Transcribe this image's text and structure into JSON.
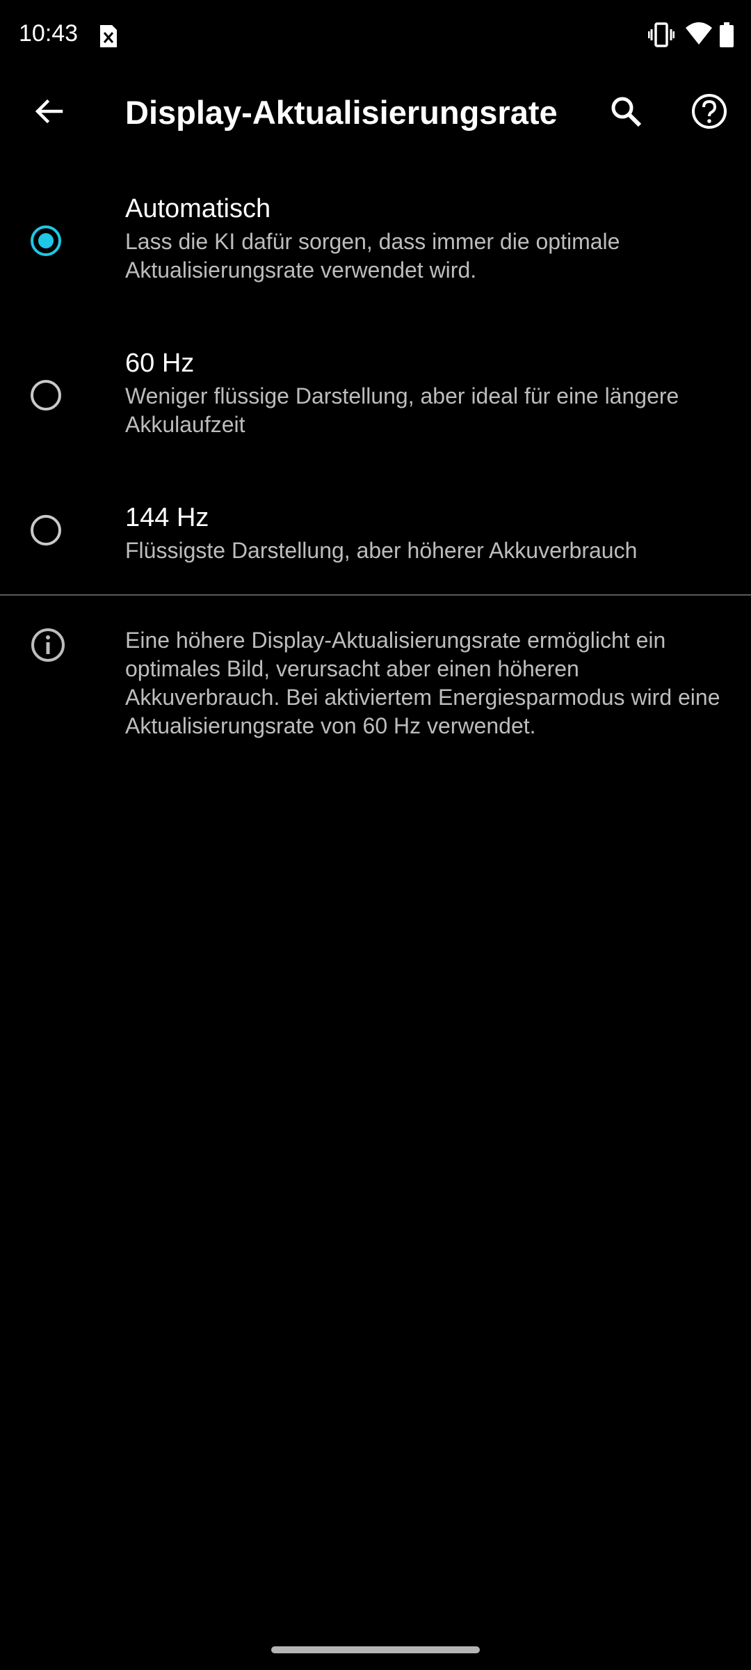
{
  "status_bar": {
    "time": "10:43",
    "icons": [
      "sim-error-icon",
      "vibrate-icon",
      "wifi-icon",
      "battery-icon"
    ]
  },
  "app_bar": {
    "title": "Display-Aktualisierungsrate",
    "actions": [
      "back-arrow-icon",
      "search-icon",
      "help-icon"
    ]
  },
  "options": [
    {
      "title": "Automatisch",
      "description": "Lass die KI dafür sorgen, dass immer die optimale Aktualisierungsrate verwendet wird.",
      "selected": true
    },
    {
      "title": "60 Hz",
      "description": "Weniger flüssige Darstellung, aber ideal für eine längere Akkulaufzeit",
      "selected": false
    },
    {
      "title": "144 Hz",
      "description": "Flüssigste Darstellung, aber höherer Akkuverbrauch",
      "selected": false
    }
  ],
  "info": {
    "text": "Eine höhere Display-Aktualisierungsrate ermöglicht ein optimales Bild, verursacht aber einen höheren Akkuverbrauch. Bei aktiviertem Energiesparmodus wird eine Aktualisierungsrate von 60 Hz verwendet."
  },
  "colors": {
    "background": "#000000",
    "accent": "#1ec8e6",
    "primary_text": "#ffffff",
    "secondary_text": "#bdbdbd"
  }
}
